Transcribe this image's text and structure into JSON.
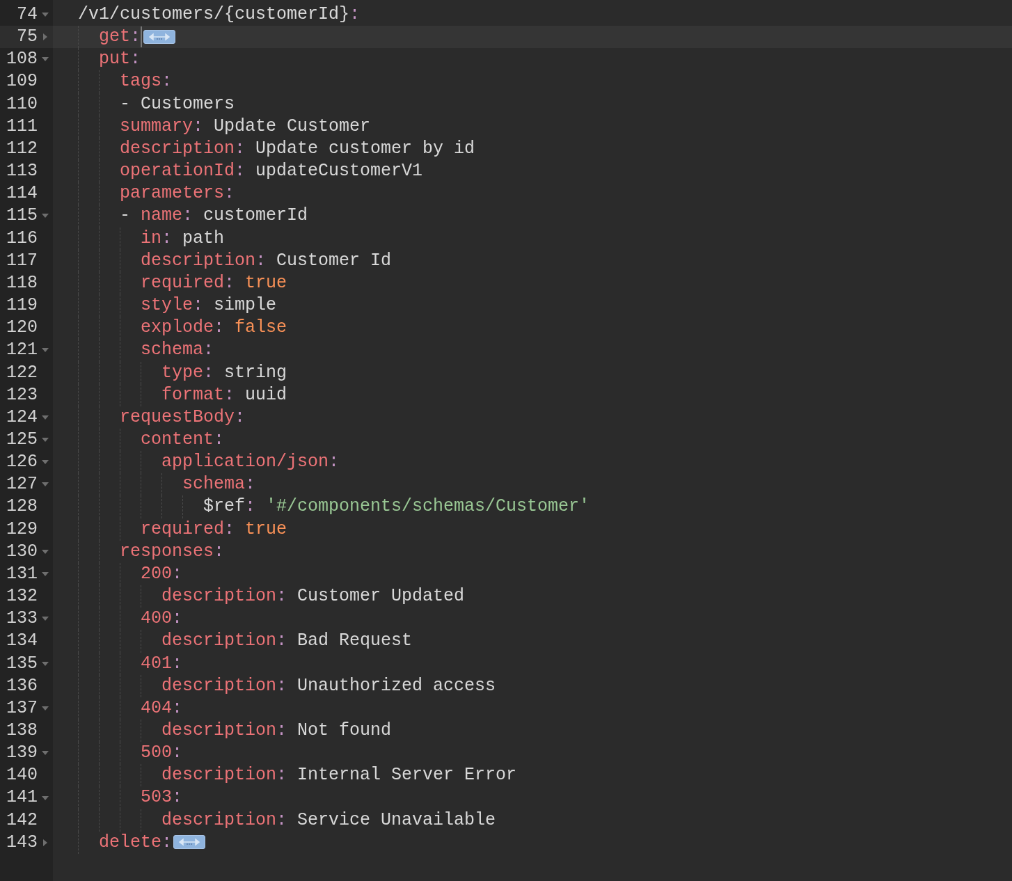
{
  "editor": {
    "lines": [
      {
        "number": "74",
        "collapsed": false,
        "selected": false,
        "tokens": [
          {
            "kind": "plain",
            "text": "  /v1/customers/{customerId}"
          },
          {
            "kind": "punct",
            "text": ":"
          }
        ]
      },
      {
        "number": "75",
        "collapsed": true,
        "selected": true,
        "tokens": [
          {
            "kind": "key",
            "text": "    get"
          },
          {
            "kind": "punct",
            "text": ":"
          }
        ]
      },
      {
        "number": "108",
        "collapsed": false,
        "selected": false,
        "tokens": [
          {
            "kind": "key",
            "text": "    put"
          },
          {
            "kind": "punct",
            "text": ":"
          }
        ]
      },
      {
        "number": "109",
        "selected": false,
        "tokens": [
          {
            "kind": "key",
            "text": "      tags"
          },
          {
            "kind": "punct",
            "text": ":"
          }
        ]
      },
      {
        "number": "110",
        "selected": false,
        "tokens": [
          {
            "kind": "plain",
            "text": "      - Customers"
          }
        ]
      },
      {
        "number": "111",
        "selected": false,
        "tokens": [
          {
            "kind": "key",
            "text": "      summary"
          },
          {
            "kind": "punct",
            "text": ":"
          },
          {
            "kind": "plain",
            "text": " Update Customer"
          }
        ]
      },
      {
        "number": "112",
        "selected": false,
        "tokens": [
          {
            "kind": "key",
            "text": "      description"
          },
          {
            "kind": "punct",
            "text": ":"
          },
          {
            "kind": "plain",
            "text": " Update customer by id"
          }
        ]
      },
      {
        "number": "113",
        "selected": false,
        "tokens": [
          {
            "kind": "key",
            "text": "      operationId"
          },
          {
            "kind": "punct",
            "text": ":"
          },
          {
            "kind": "plain",
            "text": " updateCustomerV1"
          }
        ]
      },
      {
        "number": "114",
        "selected": false,
        "tokens": [
          {
            "kind": "key",
            "text": "      parameters"
          },
          {
            "kind": "punct",
            "text": ":"
          }
        ]
      },
      {
        "number": "115",
        "collapsed": false,
        "selected": false,
        "tokens": [
          {
            "kind": "plain",
            "text": "      -"
          },
          {
            "kind": "key",
            "text": " name"
          },
          {
            "kind": "punct",
            "text": ":"
          },
          {
            "kind": "plain",
            "text": " customerId"
          }
        ]
      },
      {
        "number": "116",
        "selected": false,
        "tokens": [
          {
            "kind": "key",
            "text": "        in"
          },
          {
            "kind": "punct",
            "text": ":"
          },
          {
            "kind": "plain",
            "text": " path"
          }
        ]
      },
      {
        "number": "117",
        "selected": false,
        "tokens": [
          {
            "kind": "key",
            "text": "        description"
          },
          {
            "kind": "punct",
            "text": ":"
          },
          {
            "kind": "plain",
            "text": " Customer Id"
          }
        ]
      },
      {
        "number": "118",
        "selected": false,
        "tokens": [
          {
            "kind": "key",
            "text": "        required"
          },
          {
            "kind": "punct",
            "text": ":"
          },
          {
            "kind": "bool",
            "text": " true"
          }
        ]
      },
      {
        "number": "119",
        "selected": false,
        "tokens": [
          {
            "kind": "key",
            "text": "        style"
          },
          {
            "kind": "punct",
            "text": ":"
          },
          {
            "kind": "plain",
            "text": " simple"
          }
        ]
      },
      {
        "number": "120",
        "selected": false,
        "tokens": [
          {
            "kind": "key",
            "text": "        explode"
          },
          {
            "kind": "punct",
            "text": ":"
          },
          {
            "kind": "bool",
            "text": " false"
          }
        ]
      },
      {
        "number": "121",
        "collapsed": false,
        "selected": false,
        "tokens": [
          {
            "kind": "key",
            "text": "        schema"
          },
          {
            "kind": "punct",
            "text": ":"
          }
        ]
      },
      {
        "number": "122",
        "selected": false,
        "tokens": [
          {
            "kind": "key",
            "text": "          type"
          },
          {
            "kind": "punct",
            "text": ":"
          },
          {
            "kind": "plain",
            "text": " string"
          }
        ]
      },
      {
        "number": "123",
        "selected": false,
        "tokens": [
          {
            "kind": "key",
            "text": "          format"
          },
          {
            "kind": "punct",
            "text": ":"
          },
          {
            "kind": "plain",
            "text": " uuid"
          }
        ]
      },
      {
        "number": "124",
        "collapsed": false,
        "selected": false,
        "tokens": [
          {
            "kind": "key",
            "text": "      requestBody"
          },
          {
            "kind": "punct",
            "text": ":"
          }
        ]
      },
      {
        "number": "125",
        "collapsed": false,
        "selected": false,
        "tokens": [
          {
            "kind": "key",
            "text": "        content"
          },
          {
            "kind": "punct",
            "text": ":"
          }
        ]
      },
      {
        "number": "126",
        "collapsed": false,
        "selected": false,
        "tokens": [
          {
            "kind": "key",
            "text": "          application/json"
          },
          {
            "kind": "punct",
            "text": ":"
          }
        ]
      },
      {
        "number": "127",
        "collapsed": false,
        "selected": false,
        "tokens": [
          {
            "kind": "key",
            "text": "            schema"
          },
          {
            "kind": "punct",
            "text": ":"
          }
        ]
      },
      {
        "number": "128",
        "selected": false,
        "tokens": [
          {
            "kind": "plain",
            "text": "              $ref"
          },
          {
            "kind": "punct",
            "text": ":"
          },
          {
            "kind": "string",
            "text": " '#/components/schemas/Customer'"
          }
        ]
      },
      {
        "number": "129",
        "selected": false,
        "tokens": [
          {
            "kind": "key",
            "text": "        required"
          },
          {
            "kind": "punct",
            "text": ":"
          },
          {
            "kind": "bool",
            "text": " true"
          }
        ]
      },
      {
        "number": "130",
        "collapsed": false,
        "selected": false,
        "tokens": [
          {
            "kind": "key",
            "text": "      responses"
          },
          {
            "kind": "punct",
            "text": ":"
          }
        ]
      },
      {
        "number": "131",
        "collapsed": false,
        "selected": false,
        "tokens": [
          {
            "kind": "key",
            "text": "        200"
          },
          {
            "kind": "punct",
            "text": ":"
          }
        ]
      },
      {
        "number": "132",
        "selected": false,
        "tokens": [
          {
            "kind": "key",
            "text": "          description"
          },
          {
            "kind": "punct",
            "text": ":"
          },
          {
            "kind": "plain",
            "text": " Customer Updated"
          }
        ]
      },
      {
        "number": "133",
        "collapsed": false,
        "selected": false,
        "tokens": [
          {
            "kind": "key",
            "text": "        400"
          },
          {
            "kind": "punct",
            "text": ":"
          }
        ]
      },
      {
        "number": "134",
        "selected": false,
        "tokens": [
          {
            "kind": "key",
            "text": "          description"
          },
          {
            "kind": "punct",
            "text": ":"
          },
          {
            "kind": "plain",
            "text": " Bad Request"
          }
        ]
      },
      {
        "number": "135",
        "collapsed": false,
        "selected": false,
        "tokens": [
          {
            "kind": "key",
            "text": "        401"
          },
          {
            "kind": "punct",
            "text": ":"
          }
        ]
      },
      {
        "number": "136",
        "selected": false,
        "tokens": [
          {
            "kind": "key",
            "text": "          description"
          },
          {
            "kind": "punct",
            "text": ":"
          },
          {
            "kind": "plain",
            "text": " Unauthorized access"
          }
        ]
      },
      {
        "number": "137",
        "collapsed": false,
        "selected": false,
        "tokens": [
          {
            "kind": "key",
            "text": "        404"
          },
          {
            "kind": "punct",
            "text": ":"
          }
        ]
      },
      {
        "number": "138",
        "selected": false,
        "tokens": [
          {
            "kind": "key",
            "text": "          description"
          },
          {
            "kind": "punct",
            "text": ":"
          },
          {
            "kind": "plain",
            "text": " Not found"
          }
        ]
      },
      {
        "number": "139",
        "collapsed": false,
        "selected": false,
        "tokens": [
          {
            "kind": "key",
            "text": "        500"
          },
          {
            "kind": "punct",
            "text": ":"
          }
        ]
      },
      {
        "number": "140",
        "selected": false,
        "tokens": [
          {
            "kind": "key",
            "text": "          description"
          },
          {
            "kind": "punct",
            "text": ":"
          },
          {
            "kind": "plain",
            "text": " Internal Server Error"
          }
        ]
      },
      {
        "number": "141",
        "collapsed": false,
        "selected": false,
        "tokens": [
          {
            "kind": "key",
            "text": "        503"
          },
          {
            "kind": "punct",
            "text": ":"
          }
        ]
      },
      {
        "number": "142",
        "selected": false,
        "tokens": [
          {
            "kind": "key",
            "text": "          description"
          },
          {
            "kind": "punct",
            "text": ":"
          },
          {
            "kind": "plain",
            "text": " Service Unavailable"
          }
        ]
      },
      {
        "number": "143",
        "collapsed": true,
        "selected": false,
        "tokens": [
          {
            "kind": "key",
            "text": "    delete"
          },
          {
            "kind": "punct",
            "text": ":"
          }
        ]
      }
    ]
  }
}
